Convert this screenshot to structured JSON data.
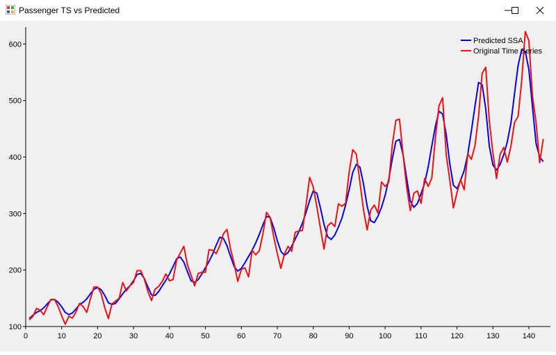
{
  "window": {
    "title": "Passenger TS vs Predicted",
    "controls": [
      "minimize",
      "maximize",
      "close"
    ]
  },
  "colors": {
    "predicted": "#0000e6",
    "original": "#ee1111",
    "background": "#f0f0f0"
  },
  "chart_data": {
    "type": "line",
    "title": "",
    "xlabel": "",
    "ylabel": "",
    "xlim": [
      0,
      146
    ],
    "ylim": [
      100,
      630
    ],
    "xticks": [
      0,
      10,
      20,
      30,
      40,
      50,
      60,
      70,
      80,
      90,
      100,
      110,
      120,
      130,
      140
    ],
    "yticks": [
      100,
      200,
      300,
      400,
      500,
      600
    ],
    "grid": false,
    "legend": "top-right",
    "x": [
      1,
      2,
      3,
      4,
      5,
      6,
      7,
      8,
      9,
      10,
      11,
      12,
      13,
      14,
      15,
      16,
      17,
      18,
      19,
      20,
      21,
      22,
      23,
      24,
      25,
      26,
      27,
      28,
      29,
      30,
      31,
      32,
      33,
      34,
      35,
      36,
      37,
      38,
      39,
      40,
      41,
      42,
      43,
      44,
      45,
      46,
      47,
      48,
      49,
      50,
      51,
      52,
      53,
      54,
      55,
      56,
      57,
      58,
      59,
      60,
      61,
      62,
      63,
      64,
      65,
      66,
      67,
      68,
      69,
      70,
      71,
      72,
      73,
      74,
      75,
      76,
      77,
      78,
      79,
      80,
      81,
      82,
      83,
      84,
      85,
      86,
      87,
      88,
      89,
      90,
      91,
      92,
      93,
      94,
      95,
      96,
      97,
      98,
      99,
      100,
      101,
      102,
      103,
      104,
      105,
      106,
      107,
      108,
      109,
      110,
      111,
      112,
      113,
      114,
      115,
      116,
      117,
      118,
      119,
      120,
      121,
      122,
      123,
      124,
      125,
      126,
      127,
      128,
      129,
      130,
      131,
      132,
      133,
      134,
      135,
      136,
      137,
      138,
      139,
      140,
      141,
      142,
      143,
      144
    ],
    "series": [
      {
        "name": "Predicted SSA",
        "values": [
          114,
          120,
          125,
          128,
          133,
          140,
          147,
          148,
          143,
          135,
          125,
          121,
          124,
          131,
          139,
          143,
          149,
          158,
          166,
          169,
          165,
          155,
          142,
          139,
          141,
          149,
          158,
          166,
          172,
          181,
          192,
          194,
          185,
          170,
          156,
          155,
          162,
          172,
          182,
          193,
          206,
          220,
          223,
          214,
          197,
          181,
          178,
          183,
          193,
          204,
          215,
          228,
          244,
          258,
          256,
          243,
          224,
          206,
          198,
          203,
          213,
          224,
          235,
          248,
          263,
          280,
          295,
          293,
          275,
          252,
          233,
          226,
          231,
          242,
          255,
          268,
          283,
          302,
          323,
          340,
          336,
          310,
          281,
          259,
          254,
          262,
          276,
          292,
          315,
          342,
          373,
          387,
          382,
          352,
          313,
          287,
          284,
          295,
          311,
          332,
          360,
          397,
          428,
          431,
          404,
          362,
          322,
          311,
          318,
          335,
          354,
          383,
          420,
          455,
          481,
          476,
          440,
          388,
          350,
          344,
          359,
          376,
          405,
          446,
          490,
          532,
          528,
          485,
          419,
          386,
          377,
          387,
          404,
          427,
          460,
          512,
          562,
          590,
          587,
          555,
          489,
          424,
          400,
          392
        ]
      },
      {
        "name": "Original Time Series",
        "values": [
          112,
          118,
          132,
          129,
          121,
          135,
          148,
          148,
          136,
          119,
          104,
          118,
          115,
          126,
          141,
          135,
          125,
          149,
          170,
          170,
          158,
          133,
          114,
          140,
          145,
          150,
          178,
          163,
          172,
          178,
          199,
          199,
          184,
          162,
          146,
          166,
          171,
          180,
          193,
          181,
          183,
          218,
          230,
          242,
          209,
          191,
          172,
          194,
          196,
          196,
          236,
          235,
          229,
          243,
          264,
          272,
          237,
          211,
          180,
          201,
          204,
          188,
          235,
          227,
          234,
          264,
          302,
          293,
          259,
          229,
          203,
          229,
          242,
          233,
          267,
          269,
          270,
          315,
          364,
          347,
          312,
          274,
          237,
          278,
          284,
          277,
          317,
          313,
          318,
          374,
          413,
          405,
          355,
          306,
          271,
          306,
          315,
          301,
          356,
          348,
          355,
          422,
          465,
          467,
          404,
          347,
          305,
          336,
          340,
          318,
          362,
          348,
          363,
          435,
          491,
          505,
          404,
          359,
          310,
          337,
          360,
          342,
          406,
          396,
          420,
          472,
          548,
          559,
          463,
          407,
          362,
          405,
          417,
          391,
          419,
          461,
          472,
          535,
          622,
          606,
          508,
          461,
          390,
          432
        ]
      }
    ]
  }
}
